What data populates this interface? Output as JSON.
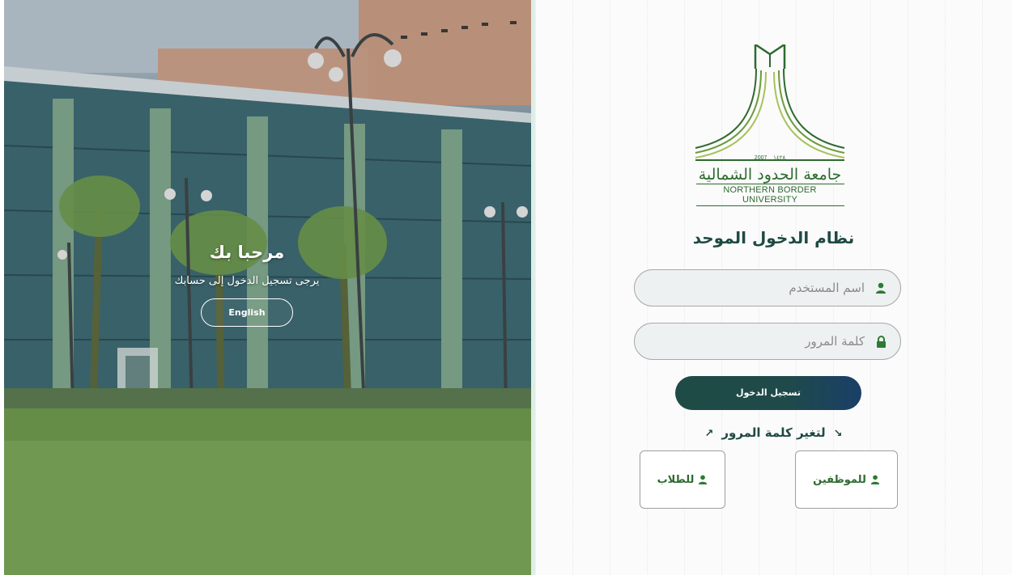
{
  "hero": {
    "title": "مرحبا بك",
    "subtitle": "يرجى تسجيل الدخول إلى حسابك",
    "language_button": "English"
  },
  "logo": {
    "year_line": "2007 _ ١٤٢٨",
    "arabic_name": "جامعة الحدود الشمالية",
    "english_name": "NORTHERN BORDER UNIVERSITY"
  },
  "login": {
    "system_title": "نظام الدخول الموحد",
    "username_placeholder": "اسم المستخدم",
    "password_placeholder": "كلمة المرور",
    "submit_label": "تسجيل الدخول",
    "change_password_label": "لتغير كلمة المرور",
    "staff_label": "للموظفين",
    "students_label": "للطلاب"
  },
  "colors": {
    "primary_dark": "#1e4a44",
    "brand_green": "#2d6a2f",
    "button_gradient_end": "#1a3f68"
  },
  "icons": {
    "user": "user-icon",
    "lock": "lock-icon",
    "arrow_down_right": "arrow-down-right-icon",
    "arrow_up_right": "arrow-up-right-icon"
  }
}
